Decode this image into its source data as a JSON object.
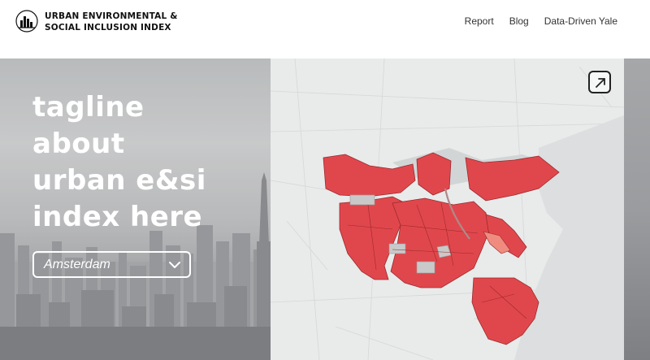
{
  "header": {
    "brand_line1": "URBAN ENVIRONMENTAL &",
    "brand_line2": "SOCIAL INCLUSION INDEX",
    "nav": [
      {
        "label": "Report"
      },
      {
        "label": "Blog"
      },
      {
        "label": "Data-Driven Yale"
      }
    ]
  },
  "hero": {
    "tagline_lines": [
      "tagline",
      "about",
      "urban e&si",
      "index here"
    ],
    "city_select": {
      "value": "Amsterdam"
    }
  },
  "map": {
    "expand_icon": "expand-arrow-icon",
    "colors": {
      "district_fill": "#e0474c",
      "district_stroke": "#9a2a2e",
      "no_data": "#c9c9c9",
      "background": "#e9eaea",
      "water": "#d9dbdc"
    }
  }
}
